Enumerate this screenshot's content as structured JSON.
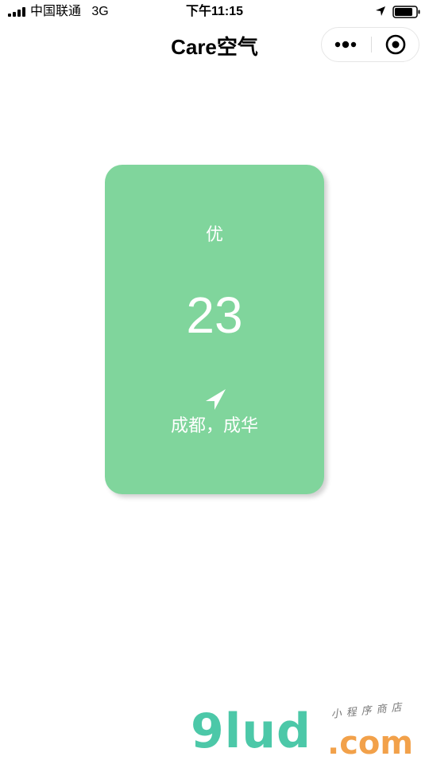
{
  "status_bar": {
    "carrier": "中国联通   3G",
    "time": "下午11:15",
    "icons": {
      "signal": "signal-bars-icon",
      "location": "location-arrow-icon",
      "battery": "battery-icon"
    }
  },
  "nav_bar": {
    "title": "Care空气",
    "capsule": {
      "more_icon": "more-dots-icon",
      "close_icon": "target-close-icon"
    }
  },
  "aqi_card": {
    "level": "优",
    "value": "23",
    "location": "成都，成华",
    "location_icon": "navigation-arrow-icon",
    "background_color": "#80d59c"
  },
  "watermark": {
    "brand": "9lud",
    "domain": ".com",
    "tagline": "小程序商店"
  },
  "colors": {
    "card_green": "#80d59c",
    "text_white": "#ffffff",
    "watermark_teal": "#4cc8a8",
    "watermark_orange": "#f2a14a"
  }
}
